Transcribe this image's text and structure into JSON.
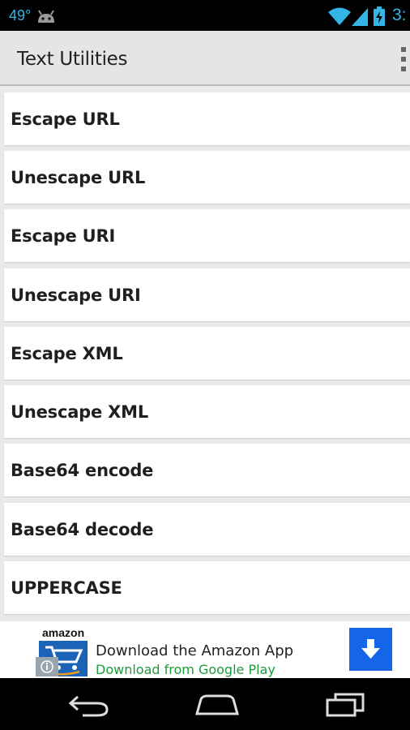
{
  "status_bar": {
    "temperature": "49°",
    "time": "3:",
    "icons": [
      "android-icon",
      "wifi-icon",
      "signal-icon",
      "battery-charging-icon"
    ]
  },
  "action_bar": {
    "title": "Text Utilities",
    "overflow_icon": "overflow-menu-icon"
  },
  "list": {
    "items": [
      {
        "label": "Escape URL"
      },
      {
        "label": "Unescape URL"
      },
      {
        "label": "Escape URI"
      },
      {
        "label": "Unescape URI"
      },
      {
        "label": "Escape XML"
      },
      {
        "label": "Unescape XML"
      },
      {
        "label": "Base64 encode"
      },
      {
        "label": "Base64 decode"
      },
      {
        "label": "UPPERCASE"
      }
    ]
  },
  "ad": {
    "brand": "amazon",
    "title": "Download the Amazon App",
    "subtitle": "Download from Google Play",
    "download_icon": "download-arrow-icon",
    "info_icon": "info-icon",
    "accent_color": "#1565e8",
    "subtitle_color": "#1a9c3a"
  },
  "nav_bar": {
    "icons": [
      "back-icon",
      "home-icon",
      "recent-apps-icon"
    ]
  },
  "colors": {
    "status_accent": "#33b5e5",
    "action_bar_bg": "#e5e5e5",
    "list_bg": "#e9e9e9",
    "item_bg": "#ffffff"
  }
}
